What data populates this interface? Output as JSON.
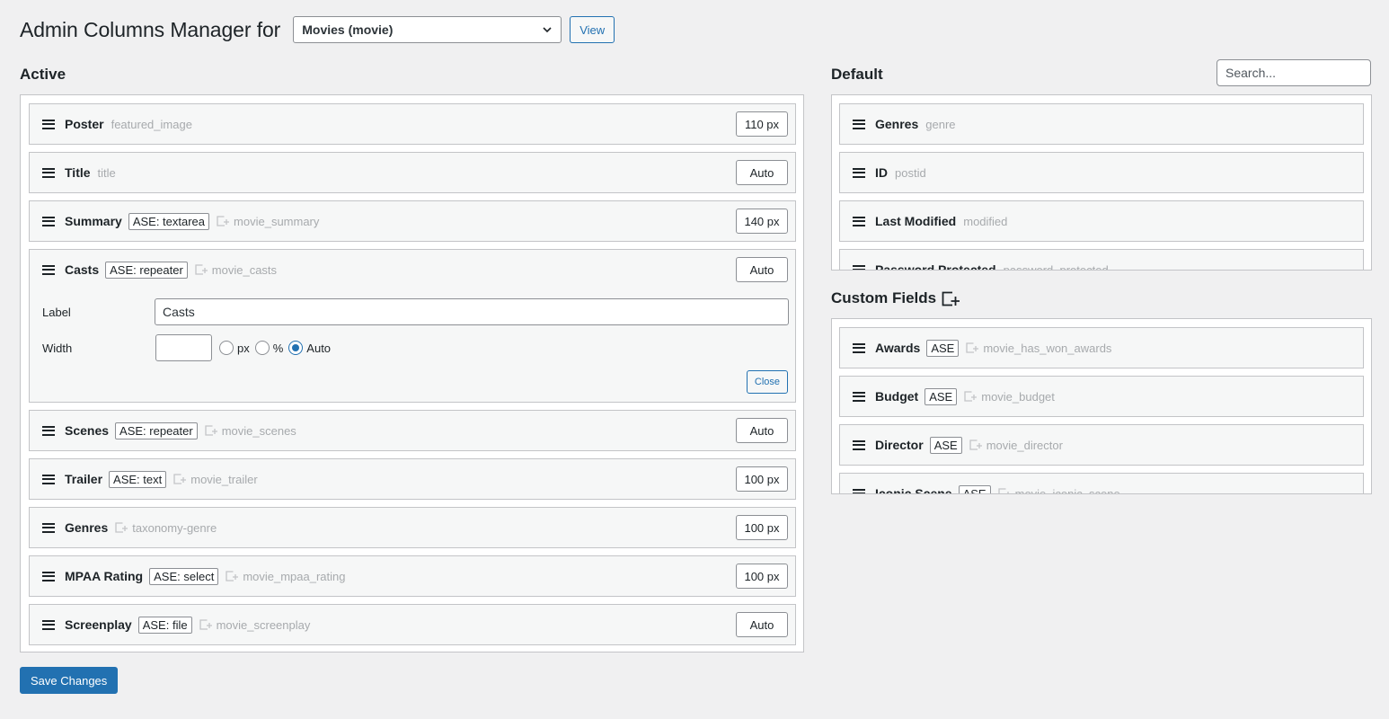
{
  "header": {
    "title": "Admin Columns Manager for",
    "post_type_select": "Movies (movie)",
    "view_button": "View"
  },
  "active": {
    "title": "Active",
    "columns": [
      {
        "label": "Poster",
        "type": "featured_image",
        "width": "110 px"
      },
      {
        "label": "Title",
        "type": "title",
        "width": "Auto"
      },
      {
        "label": "Summary",
        "badge": "ASE: textarea",
        "meta_key": "movie_summary",
        "width": "140 px"
      },
      {
        "label": "Casts",
        "badge": "ASE: repeater",
        "meta_key": "movie_casts",
        "width": "Auto"
      },
      {
        "label": "Scenes",
        "badge": "ASE: repeater",
        "meta_key": "movie_scenes",
        "width": "Auto"
      },
      {
        "label": "Trailer",
        "badge": "ASE: text",
        "meta_key": "movie_trailer",
        "width": "100 px"
      },
      {
        "label": "Genres",
        "meta_key": "taxonomy-genre",
        "width": "100 px"
      },
      {
        "label": "MPAA Rating",
        "badge": "ASE: select",
        "meta_key": "movie_mpaa_rating",
        "width": "100 px"
      },
      {
        "label": "Screenplay",
        "badge": "ASE: file",
        "meta_key": "movie_screenplay",
        "width": "Auto"
      }
    ],
    "settings": {
      "label_field_label": "Label",
      "label_value": "Casts",
      "width_field_label": "Width",
      "width_value": "",
      "unit_options": [
        "px",
        "%",
        "Auto"
      ],
      "unit_selected": "Auto",
      "close_button": "Close"
    }
  },
  "default": {
    "title": "Default",
    "search_placeholder": "Search...",
    "columns": [
      {
        "label": "Genres",
        "type": "genre"
      },
      {
        "label": "ID",
        "type": "postid"
      },
      {
        "label": "Last Modified",
        "type": "modified"
      },
      {
        "label": "Password Protected",
        "type": "password_protected"
      }
    ]
  },
  "custom_fields": {
    "title": "Custom Fields",
    "columns": [
      {
        "label": "Awards",
        "badge": "ASE",
        "meta_key": "movie_has_won_awards"
      },
      {
        "label": "Budget",
        "badge": "ASE",
        "meta_key": "movie_budget"
      },
      {
        "label": "Director",
        "badge": "ASE",
        "meta_key": "movie_director"
      },
      {
        "label": "Iconic Scene",
        "badge": "ASE",
        "meta_key": "movie_iconic_scene"
      }
    ]
  },
  "footer": {
    "save_button": "Save Changes"
  },
  "colors": {
    "accent": "#2271b1",
    "background": "#f0f0f1",
    "muted_text": "#a7aaad"
  }
}
